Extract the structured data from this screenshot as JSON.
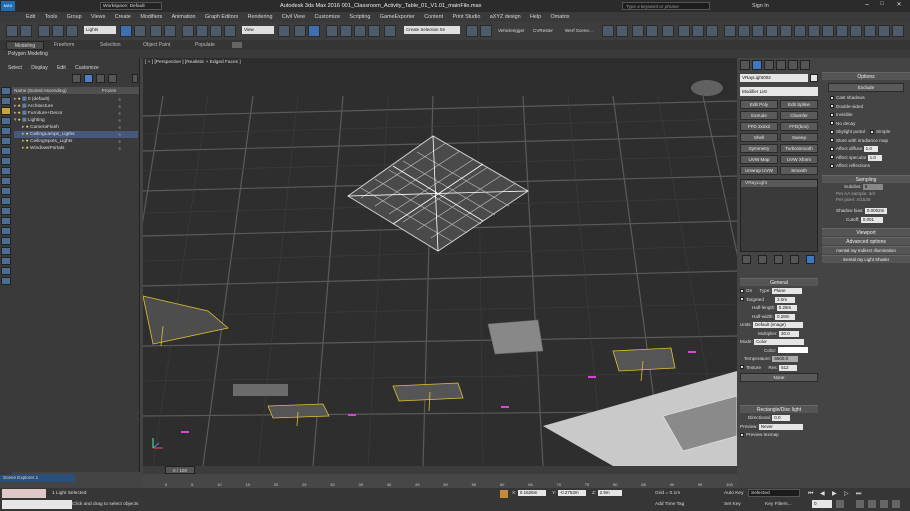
{
  "titlebar": {
    "app": "MAX",
    "workspace": "Workspace: Default",
    "title": "Autodesk 3ds Max 2016     001_Classroom_Activity_Table_01_V1.01_mainFile.max",
    "search": "Type a keyword or phrase",
    "sign_in": "Sign In"
  },
  "menus": [
    "Edit",
    "Tools",
    "Group",
    "Views",
    "Create",
    "Modifiers",
    "Animation",
    "Graph Editors",
    "Rendering",
    "Civil View",
    "Customize",
    "Scripting",
    "GameExporter",
    "Content",
    "Print Studio",
    "aXYZ design",
    "Help",
    "Omatrix"
  ],
  "toolbar": {
    "selection_filter": "Lights",
    "view_dropdown": "View",
    "named_selection": "Create Selection Se",
    "plugins": [
      "Vehiclerigger",
      "CVRester",
      "Werf Scene..."
    ]
  },
  "ribbon": {
    "tabs": [
      "Modeling",
      "Freeform",
      "Selection",
      "Object Paint",
      "Populate"
    ],
    "sub": "Polygon Modeling"
  },
  "scene_explorer": {
    "menus": [
      "Select",
      "Display",
      "Edit",
      "Customize"
    ],
    "col_name": "Name (Sorted Ascending)",
    "col_frozen": "Frozen",
    "items": [
      {
        "name": "0 (default)",
        "level": 1
      },
      {
        "name": "Architecture",
        "level": 1
      },
      {
        "name": "Furniture+Decor",
        "level": 1
      },
      {
        "name": "Lighting",
        "level": 1
      },
      {
        "name": "CameraFlash",
        "level": 2
      },
      {
        "name": "CeilingLamps_Ligths",
        "level": 2,
        "selected": true
      },
      {
        "name": "CeilingSpots_Lights",
        "level": 2
      },
      {
        "name": "WindowsPortals",
        "level": 2
      }
    ],
    "footer": "Scene Explorer 1"
  },
  "viewport": {
    "label": "[ + ] [Perspective ] [Realistic + Edged Faces ]"
  },
  "command_panel": {
    "object_name": "VRayLight002",
    "modifier_list": "Modifier List",
    "mod_buttons": [
      [
        "Edit Poly",
        "Edit Spline"
      ],
      [
        "Extrude",
        "Chamfer"
      ],
      [
        "FFD 2x2x2",
        "FFD(box)"
      ],
      [
        "Shell",
        "Sweep"
      ],
      [
        "Symmetry",
        "TurboSmooth"
      ],
      [
        "UVW Map",
        "UVW Xform"
      ],
      [
        "Unwrap UVW",
        "Smooth"
      ]
    ],
    "stack_item": "VRayLight",
    "general": {
      "header": "General",
      "on_label": "On",
      "type_label": "Type:",
      "type": "Plane",
      "targeted": "Targeted",
      "targeted_val": "2.0m",
      "half_length_label": "Half-length:",
      "half_length": "0.28m",
      "half_width_label": "Half-width:",
      "half_width": "0.28m",
      "units_label": "Units:",
      "units": "Default (image)",
      "multiplier_label": "Multiplier:",
      "multiplier": "30.0",
      "mode_label": "Mode:",
      "mode": "Color",
      "color_label": "Color:",
      "temperature_label": "Temperature:",
      "temperature": "6500.0",
      "texture_label": "Texture",
      "res_label": "Res:",
      "res": "512",
      "none": "None"
    },
    "rect": {
      "header": "Rectangle/Disc light",
      "directional_label": "Directional:",
      "directional": "0.0",
      "preview_label": "Preview:",
      "preview": "Never",
      "preview_texmap": "Preview texmap"
    }
  },
  "options": {
    "header": "Options",
    "exclude": "Exclude",
    "items": [
      "Cast shadows",
      "Double-sided",
      "Invisible",
      "No decay",
      "Skylight portal",
      "Store with irradiance map",
      "Affect diffuse",
      "Affect specular",
      "Affect reflections"
    ],
    "simple": "Simple",
    "diffuse_val": "1.0",
    "specular_val": "1.0",
    "sampling": {
      "header": "Sampling",
      "subdivs_label": "Subdivs:",
      "subdivs": "8",
      "per_aa": "Per AA sample: 4/4",
      "per_pixel": "Per pixel: 4/1536",
      "shadow_bias_label": "Shadow bias:",
      "shadow_bias": "0.0002m",
      "cutoff_label": "Cutoff:",
      "cutoff": "0.001"
    },
    "rollouts": [
      "Viewport",
      "Advanced options",
      "mental ray Indirect Illumination",
      "mental ray Light Shader"
    ]
  },
  "timeline": {
    "frame": "0 / 100",
    "ticks": [
      "0",
      "5",
      "10",
      "15",
      "20",
      "25",
      "30",
      "35",
      "40",
      "45",
      "50",
      "55",
      "60",
      "65",
      "70",
      "75",
      "80",
      "85",
      "90",
      "95",
      "100"
    ]
  },
  "status": {
    "selected": "1 Light Selected",
    "hint": "Click and drag to select objects",
    "x_label": "X:",
    "x": "0.1626m",
    "y_label": "Y:",
    "y": "-0.2753m",
    "z_label": "Z:",
    "z": "2.9m",
    "grid": "Grid = 0.1m",
    "add_time_tag": "Add Time Tag",
    "autokey": "Auto Key",
    "setkey": "Set Key",
    "selected_dd": "Selected",
    "key_filters": "Key Filters...",
    "frame_field": "0"
  }
}
